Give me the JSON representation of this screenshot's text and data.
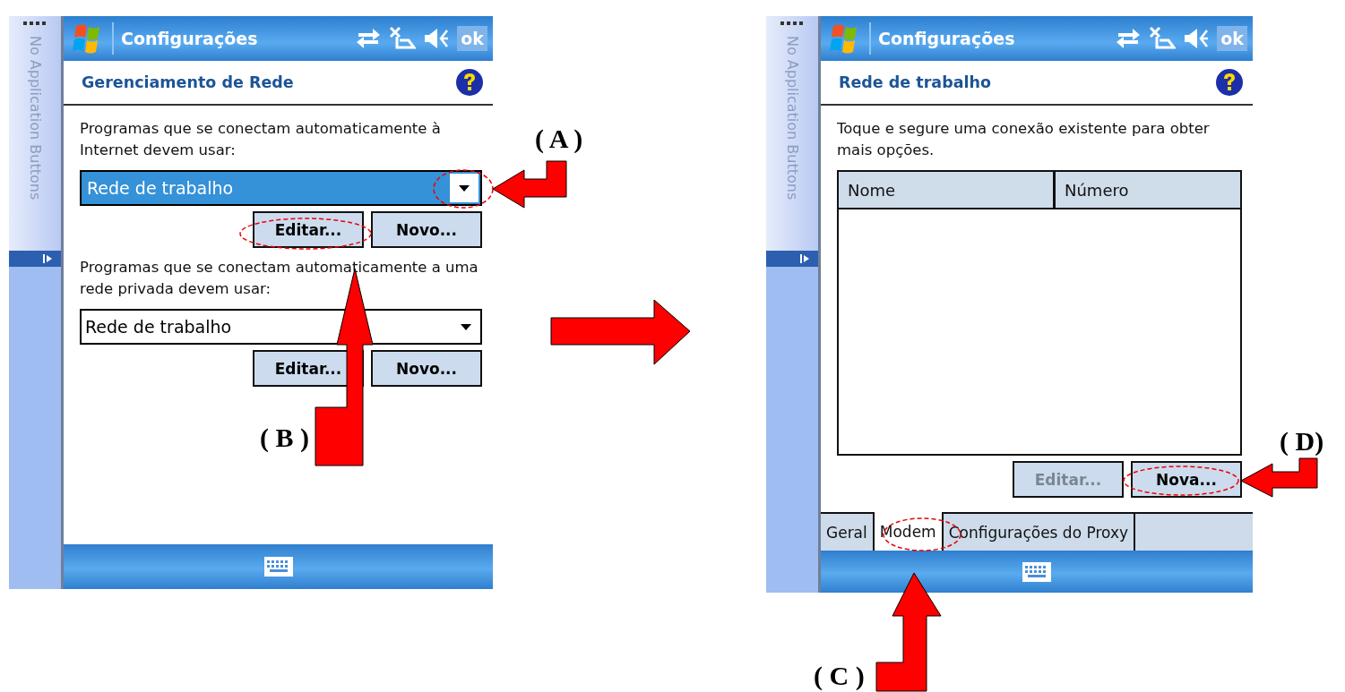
{
  "screens": [
    {
      "sidebar_label": "No Application Buttons",
      "title": "Configurações",
      "ok_label": "ok",
      "heading": "Gerenciamento de Rede",
      "body": [
        {
          "kind": "text",
          "text": "Programas que se conectam automaticamente à Internet devem usar:"
        },
        {
          "kind": "dropdown",
          "value": "Rede de trabalho",
          "focused": true
        },
        {
          "kind": "buttons",
          "buttons": [
            {
              "label": "Editar...",
              "disabled": false
            },
            {
              "label": "Novo...",
              "disabled": false
            }
          ]
        },
        {
          "kind": "text",
          "text": "Programas que se conectam automaticamente a uma rede privada devem usar:"
        },
        {
          "kind": "dropdown",
          "value": "Rede de trabalho",
          "focused": false
        },
        {
          "kind": "buttons",
          "buttons": [
            {
              "label": "Editar...",
              "disabled": false
            },
            {
              "label": "Novo...",
              "disabled": false
            }
          ]
        }
      ]
    },
    {
      "sidebar_label": "No Application Buttons",
      "title": "Configurações",
      "ok_label": "ok",
      "heading": "Rede de trabalho",
      "body": [
        {
          "kind": "text",
          "text": "Toque e segure uma conexão existente para obter mais opções."
        },
        {
          "kind": "list",
          "columns": [
            "Nome",
            "Número"
          ]
        },
        {
          "kind": "buttons",
          "buttons": [
            {
              "label": "Editar...",
              "disabled": true
            },
            {
              "label": "Nova...",
              "disabled": false
            }
          ]
        }
      ],
      "tabs": [
        {
          "label": "Geral",
          "selected": false
        },
        {
          "label": "Modem",
          "selected": true
        },
        {
          "label": "Configurações do Proxy",
          "selected": false
        }
      ]
    }
  ],
  "annotations": [
    "( A )",
    "( B )",
    "( C )",
    "( D)"
  ]
}
